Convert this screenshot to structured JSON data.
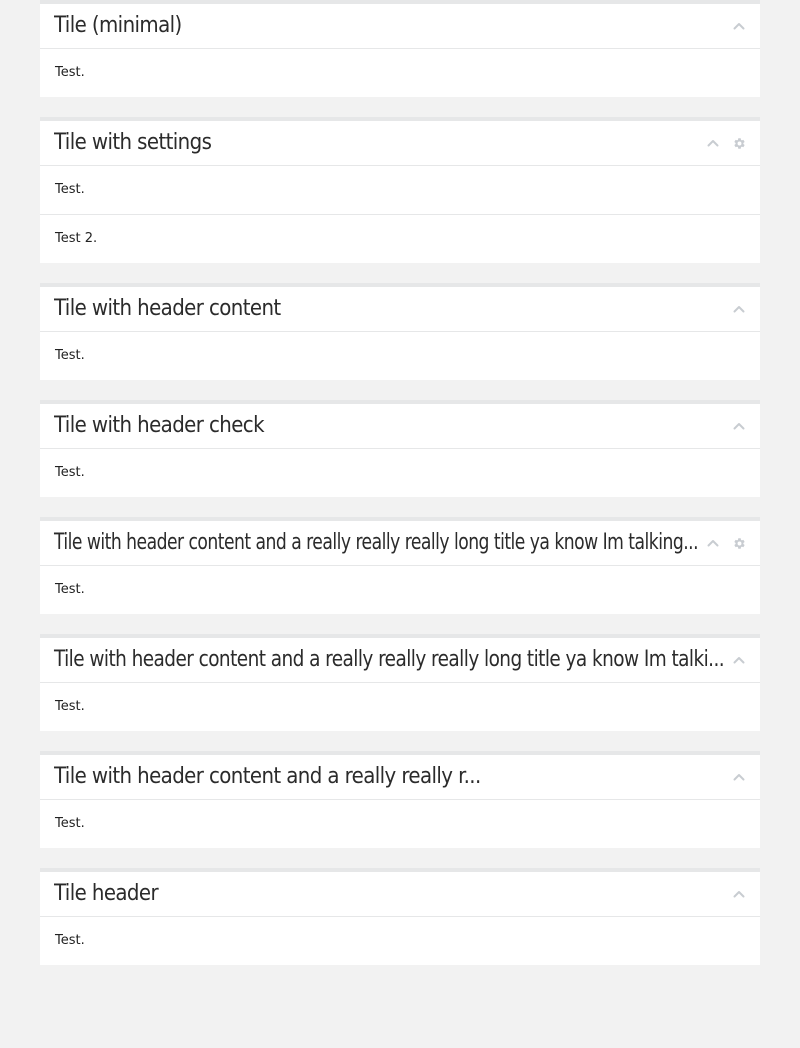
{
  "tiles": [
    {
      "title": "Tile (minimal)",
      "has_settings": false,
      "rows": [
        "Test."
      ]
    },
    {
      "title": "Tile with settings",
      "has_settings": true,
      "rows": [
        "Test.",
        "Test 2."
      ]
    },
    {
      "title": "Tile with header content",
      "has_settings": false,
      "rows": [
        "Test."
      ]
    },
    {
      "title": "Tile with header check",
      "has_settings": false,
      "rows": [
        "Test."
      ]
    },
    {
      "title": "Tile with header content and a really really really long title ya know Im talking...",
      "has_settings": true,
      "rows": [
        "Test."
      ]
    },
    {
      "title": "Tile with header content and a really really really long title ya know Im talki...",
      "has_settings": false,
      "rows": [
        "Test."
      ]
    },
    {
      "title": "Tile with header content and a really really r...",
      "has_settings": false,
      "rows": [
        "Test."
      ]
    },
    {
      "title": "Tile header",
      "has_settings": false,
      "rows": [
        "Test."
      ]
    }
  ],
  "icons": {
    "collapse": "chevron-up-icon",
    "settings": "gear-icon"
  },
  "colors": {
    "page_background": "#f2f2f2",
    "tile_background": "#ffffff",
    "divider": "#e6e7e8",
    "icon": "#c8ccd1"
  }
}
